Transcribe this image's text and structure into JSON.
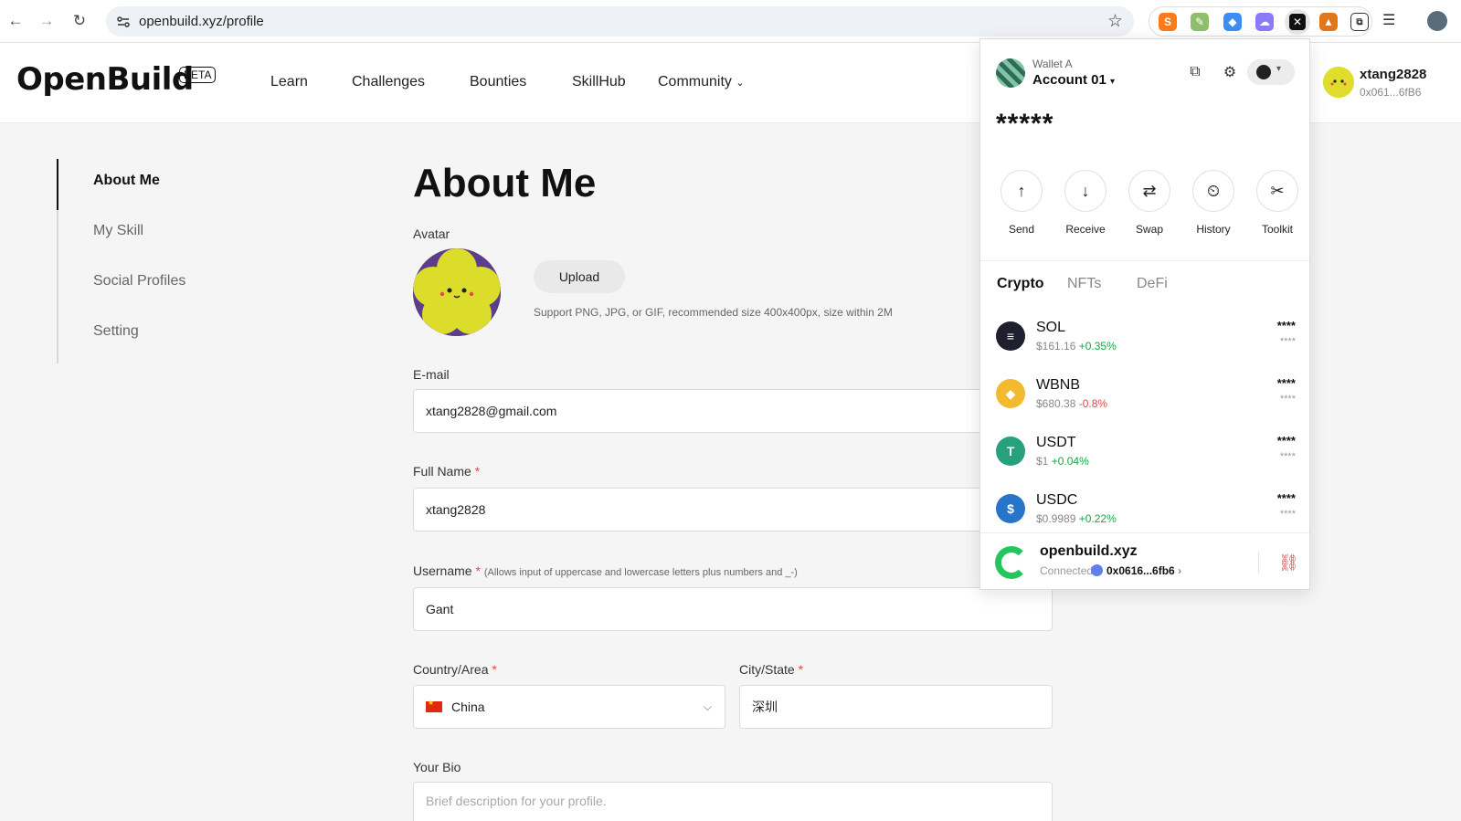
{
  "browser": {
    "url": "openbuild.xyz/profile",
    "back_icon": "arrow-left-icon",
    "forward_icon": "arrow-right-icon",
    "reload_icon": "reload-icon",
    "bookmark_icon": "star-icon"
  },
  "header": {
    "logo": "OpenBuild",
    "beta_badge": "BETA",
    "nav": [
      "Learn",
      "Challenges",
      "Bounties",
      "SkillHub",
      "Community"
    ],
    "user": {
      "name": "xtang2828",
      "address": "0x061...6fB6"
    }
  },
  "sidebar": {
    "items": [
      {
        "label": "About Me",
        "active": true
      },
      {
        "label": "My Skill",
        "active": false
      },
      {
        "label": "Social Profiles",
        "active": false
      },
      {
        "label": "Setting",
        "active": false
      }
    ]
  },
  "form": {
    "title": "About Me",
    "avatar_label": "Avatar",
    "upload_label": "Upload",
    "upload_hint": "Support PNG, JPG, or GIF, recommended size 400x400px, size within 2M",
    "email": {
      "label": "E-mail",
      "value": "xtang2828@gmail.com"
    },
    "full_name": {
      "label": "Full Name",
      "value": "xtang2828"
    },
    "username": {
      "label": "Username",
      "hint": "(Allows input of uppercase and lowercase letters plus numbers and _-)",
      "value": "Gant"
    },
    "country": {
      "label": "Country/Area",
      "value": "China"
    },
    "city": {
      "label": "City/State",
      "value": "深圳"
    },
    "bio": {
      "label": "Your Bio",
      "placeholder": "Brief description for your profile."
    },
    "required_mark": "*"
  },
  "wallet": {
    "wallet_name": "Wallet A",
    "account": "Account 01",
    "balance": "*****",
    "actions": [
      "Send",
      "Receive",
      "Swap",
      "History",
      "Toolkit"
    ],
    "tabs": [
      {
        "label": "Crypto",
        "active": true
      },
      {
        "label": "NFTs",
        "active": false
      },
      {
        "label": "DeFi",
        "active": false
      }
    ],
    "tokens": [
      {
        "symbol": "SOL",
        "price": "$161.16",
        "change": "+0.35%",
        "dir": "pos",
        "value": "****",
        "sub": "****",
        "color": "#1f1f2e"
      },
      {
        "symbol": "WBNB",
        "price": "$680.38",
        "change": "-0.8%",
        "dir": "neg",
        "value": "****",
        "sub": "****",
        "color": "#f3ba2f"
      },
      {
        "symbol": "USDT",
        "price": "$1",
        "change": "+0.04%",
        "dir": "pos",
        "value": "****",
        "sub": "****",
        "color": "#26a17b"
      },
      {
        "symbol": "USDC",
        "price": "$0.9989",
        "change": "+0.22%",
        "dir": "pos",
        "value": "****",
        "sub": "****",
        "color": "#2775ca"
      }
    ],
    "site": {
      "name": "openbuild.xyz",
      "status": "Connected",
      "address": "0x0616...6fb6"
    }
  }
}
